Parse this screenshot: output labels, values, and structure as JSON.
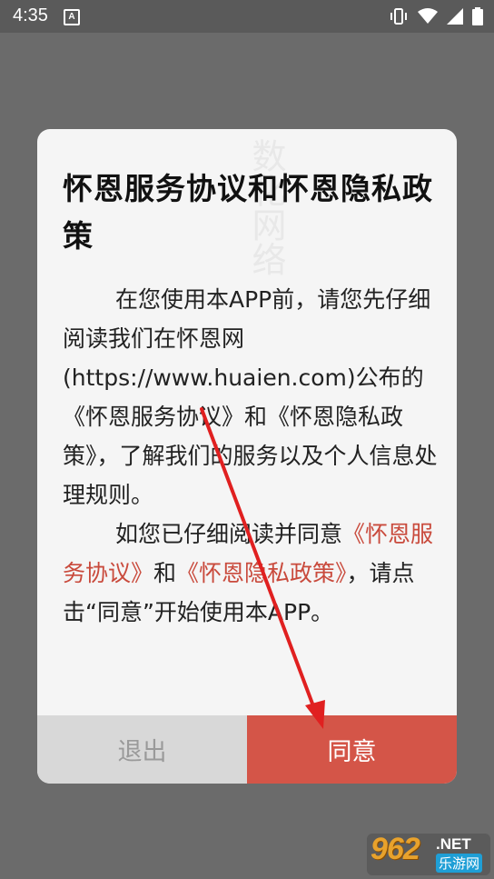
{
  "status_bar": {
    "time": "4:35",
    "notification_icon_letter": "A",
    "icons": [
      "vibrate-icon",
      "wifi-icon",
      "signal-icon",
      "battery-icon"
    ]
  },
  "dialog": {
    "watermark": "数化网络",
    "title": "怀恩服务协议和怀恩隐私政策",
    "para1_text": "在您使用本APP前，请您先仔细阅读我们在怀恩网(https://www.huaien.com)公布的《怀恩服务协议》和《怀恩隐私政策》，了解我们的服务以及个人信息处理规则。",
    "para2_prefix": "如您已仔细阅读并同意",
    "link_service": "《怀恩服务协议》",
    "para2_and": "和",
    "link_privacy": "《怀恩隐私政策》",
    "para2_suffix": "，请点击“同意”开始使用本APP。",
    "exit_label": "退出",
    "agree_label": "同意"
  },
  "colors": {
    "accent": "#d45548",
    "link": "#c94a3c",
    "exit_bg": "#d8d8d8",
    "overlay": "#6b6b6b",
    "annotation_arrow": "#e02020"
  },
  "watermark_logo": {
    "number": "962",
    "suffix": ".NET",
    "cn": "乐游网"
  }
}
